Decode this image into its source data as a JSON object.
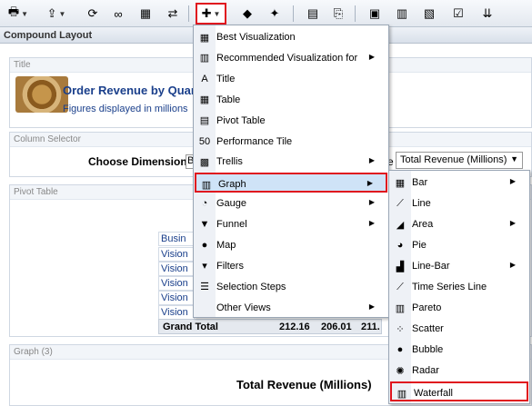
{
  "toolbar": {
    "buttons": [
      "print-icon",
      "export-icon",
      "refresh-icon",
      "preview-icon",
      "filter-icon",
      "sync-icon",
      "new-view-icon",
      "shape-icon",
      "star-icon",
      "xml-icon",
      "pdf-icon",
      "copy-icon",
      "bullet-icon",
      "lines-icon",
      "checklist-icon",
      "download-icon"
    ]
  },
  "compound": {
    "title": "Compound Layout"
  },
  "panels": {
    "title_panel": {
      "header": "Title",
      "main": "Order Revenue by Quart",
      "sub": "Figures displayed in millions"
    },
    "column_selector": {
      "header": "Column Selector",
      "choose_label": "Choose Dimension",
      "choose_value": "B",
      "tail": "e",
      "select_value": "Total Revenue (Millions)"
    },
    "pivot_table": {
      "header": "Pivot Table",
      "rows": [
        "Busin",
        "Vision",
        "Vision",
        "Vision",
        "Vision",
        "Vision"
      ],
      "grand_total": {
        "label": "Grand Total",
        "values": [
          "212.16",
          "206.01",
          "211."
        ]
      }
    },
    "graph": {
      "header": "Graph (3)",
      "title": "Total Revenue (Millions)"
    }
  },
  "main_menu": {
    "items": [
      {
        "label": "Best Visualization",
        "icon": "best-viz-icon",
        "sub": false
      },
      {
        "label": "Recommended Visualization for",
        "icon": "recommend-icon",
        "sub": true
      },
      {
        "label": "Title",
        "icon": "title-icon",
        "sub": false
      },
      {
        "label": "Table",
        "icon": "table-icon",
        "sub": false
      },
      {
        "label": "Pivot Table",
        "icon": "pivot-icon",
        "sub": false
      },
      {
        "label": "Performance Tile",
        "icon": "perf-tile-icon",
        "sub": false
      },
      {
        "label": "Trellis",
        "icon": "trellis-icon",
        "sub": true
      },
      {
        "label": "Graph",
        "icon": "graph-icon",
        "sub": true
      },
      {
        "label": "Gauge",
        "icon": "gauge-icon",
        "sub": true
      },
      {
        "label": "Funnel",
        "icon": "funnel-icon",
        "sub": true
      },
      {
        "label": "Map",
        "icon": "map-icon",
        "sub": false
      },
      {
        "label": "Filters",
        "icon": "filter-icon",
        "sub": false
      },
      {
        "label": "Selection Steps",
        "icon": "steps-icon",
        "sub": false
      },
      {
        "label": "Other Views",
        "icon": "",
        "sub": true
      }
    ]
  },
  "graph_menu": {
    "items": [
      {
        "label": "Bar",
        "icon": "bar-icon",
        "sub": true
      },
      {
        "label": "Line",
        "icon": "line-icon",
        "sub": false
      },
      {
        "label": "Area",
        "icon": "area-icon",
        "sub": true
      },
      {
        "label": "Pie",
        "icon": "pie-icon",
        "sub": false
      },
      {
        "label": "Line-Bar",
        "icon": "line-bar-icon",
        "sub": true
      },
      {
        "label": "Time Series Line",
        "icon": "time-series-icon",
        "sub": false
      },
      {
        "label": "Pareto",
        "icon": "pareto-icon",
        "sub": false
      },
      {
        "label": "Scatter",
        "icon": "scatter-icon",
        "sub": false
      },
      {
        "label": "Bubble",
        "icon": "bubble-icon",
        "sub": false
      },
      {
        "label": "Radar",
        "icon": "radar-icon",
        "sub": false
      },
      {
        "label": "Waterfall",
        "icon": "waterfall-icon",
        "sub": false
      }
    ]
  },
  "colors": {
    "highlight": "#cfe3f7",
    "red_box": "#e0141e",
    "link": "#1a3f8b"
  }
}
